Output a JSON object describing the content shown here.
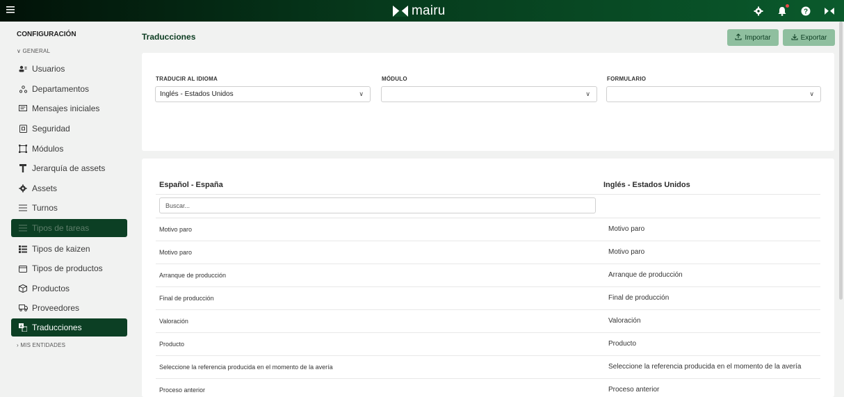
{
  "header": {
    "brand": "mairu",
    "icons": [
      "menu-icon",
      "gear-icon",
      "bell-icon",
      "help-icon",
      "user-icon"
    ],
    "colors": {
      "topbar_dark": "#021208",
      "topbar_light": "#0a5a2c",
      "active_item": "#0c3f24",
      "button_bg": "#8fbf9f",
      "notification_dot": "#e84848"
    }
  },
  "sidebar": {
    "title": "CONFIGURACIÓN",
    "general_label": "GENERAL",
    "items": [
      {
        "label": "Usuarios",
        "icon": "users-icon"
      },
      {
        "label": "Departamentos",
        "icon": "department-icon"
      },
      {
        "label": "Mensajes iniciales",
        "icon": "message-icon"
      },
      {
        "label": "Seguridad",
        "icon": "security-icon"
      },
      {
        "label": "Módulos",
        "icon": "modules-icon"
      },
      {
        "label": "Jerarquía de assets",
        "icon": "hierarchy-icon"
      },
      {
        "label": "Assets",
        "icon": "gear-icon"
      },
      {
        "label": "Turnos",
        "icon": "list-icon"
      },
      {
        "label": "Tipos de tareas",
        "icon": "list-icon"
      },
      {
        "label": "Tipos de kaizen",
        "icon": "kaizen-icon"
      },
      {
        "label": "Tipos de productos",
        "icon": "folder-icon"
      },
      {
        "label": "Productos",
        "icon": "box-icon"
      },
      {
        "label": "Proveedores",
        "icon": "truck-icon"
      },
      {
        "label": "Traducciones",
        "icon": "translate-icon"
      }
    ],
    "entities_label": "MIS ENTIDADES"
  },
  "main": {
    "title": "Traducciones",
    "import_label": "Importar",
    "export_label": "Exportar",
    "filters": {
      "language_label": "TRADUCIR AL IDIOMA",
      "language_value": "Inglés - Estados Unidos",
      "module_label": "MÓDULO",
      "module_value": "",
      "form_label": "FORMULARIO",
      "form_value": ""
    },
    "table": {
      "source_header": "Español - España",
      "target_header": "Inglés - Estados Unidos",
      "search_placeholder": "Buscar...",
      "rows": [
        {
          "es": "Motivo paro",
          "en": "Motivo paro"
        },
        {
          "es": "Motivo paro",
          "en": "Motivo paro"
        },
        {
          "es": "Arranque de producción",
          "en": "Arranque de producción"
        },
        {
          "es": "Final de producción",
          "en": "Final de producción"
        },
        {
          "es": "Valoración",
          "en": "Valoración"
        },
        {
          "es": "Producto",
          "en": "Producto"
        },
        {
          "es": "Seleccione la referencia producida en el momento de la avería",
          "en": "Seleccione la referencia producida en el momento de la avería"
        },
        {
          "es": "Proceso anterior",
          "en": "Proceso anterior"
        }
      ]
    }
  }
}
